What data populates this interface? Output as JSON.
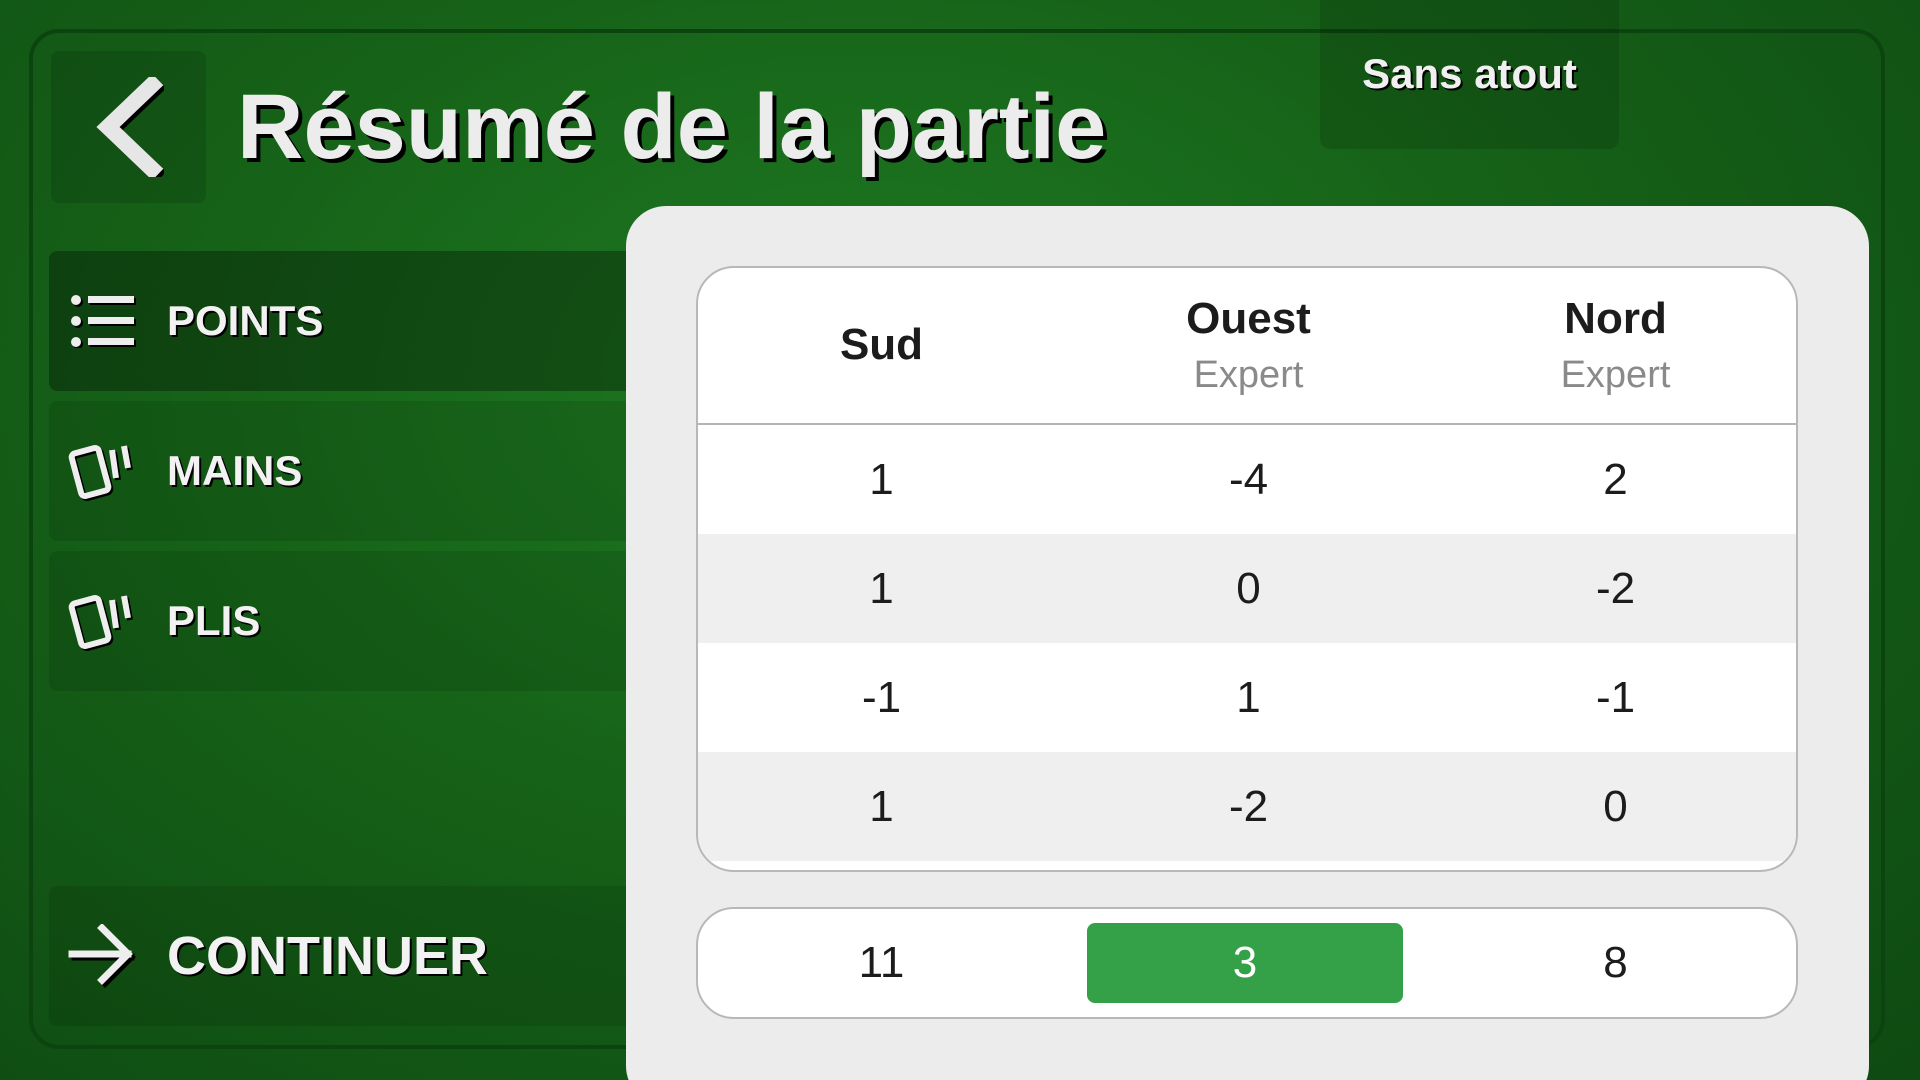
{
  "header": {
    "title": "Résumé de la partie",
    "mode": "Sans atout"
  },
  "sidebar": {
    "items": [
      {
        "label": "POINTS",
        "icon": "list-icon",
        "active": true
      },
      {
        "label": "MAINS",
        "icon": "cards-icon",
        "active": false
      },
      {
        "label": "PLIS",
        "icon": "cards-icon",
        "active": false
      }
    ],
    "continue_label": "CONTINUER",
    "continue_icon": "arrow-right-icon"
  },
  "table": {
    "columns": [
      {
        "name": "Sud",
        "level": ""
      },
      {
        "name": "Ouest",
        "level": "Expert"
      },
      {
        "name": "Nord",
        "level": "Expert"
      }
    ],
    "rows": [
      [
        "1",
        "-4",
        "2"
      ],
      [
        "1",
        "0",
        "-2"
      ],
      [
        "-1",
        "1",
        "-1"
      ],
      [
        "1",
        "-2",
        "0"
      ]
    ],
    "totals": [
      "11",
      "3",
      "8"
    ],
    "highlight_index": 1
  },
  "colors": {
    "felt": "#166218",
    "highlight": "#34a047",
    "panel": "#ececec"
  }
}
